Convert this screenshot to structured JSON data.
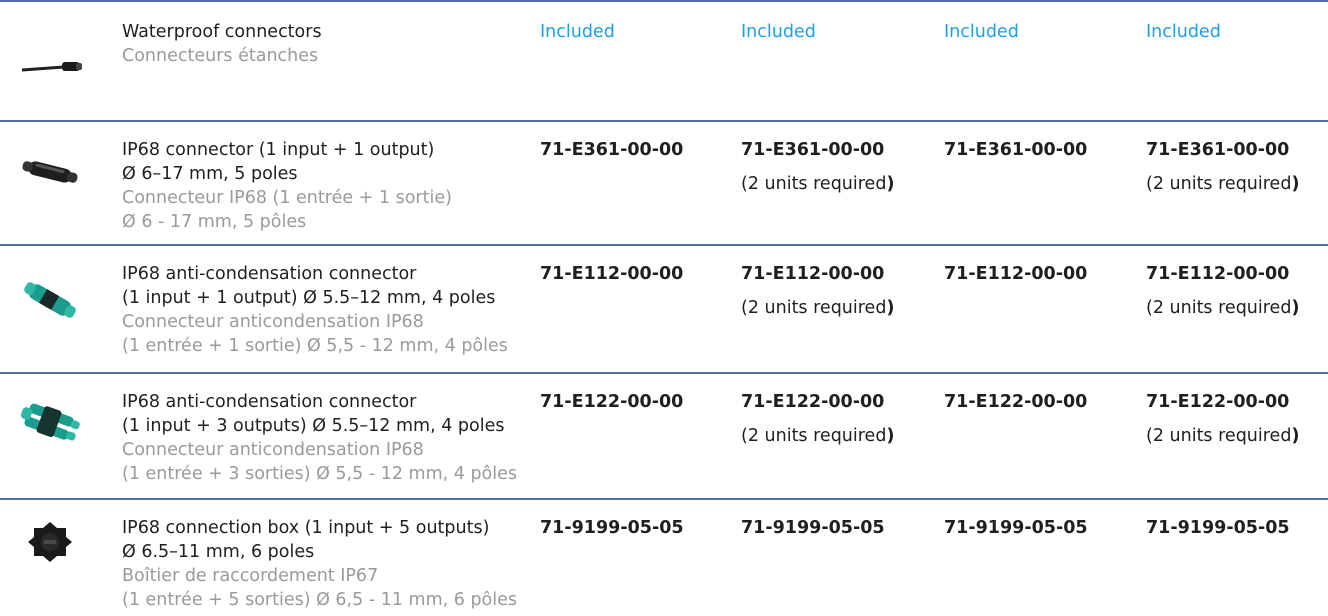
{
  "rows": [
    {
      "icon": "waterproof-connector-cable",
      "en_lines": [
        "Waterproof connectors"
      ],
      "fr_lines": [
        "Connecteurs étanches"
      ],
      "cells": [
        {
          "type": "included",
          "text": "Included"
        },
        {
          "type": "included",
          "text": "Included"
        },
        {
          "type": "included",
          "text": "Included"
        },
        {
          "type": "included",
          "text": "Included"
        }
      ]
    },
    {
      "icon": "ip68-connector",
      "en_lines": [
        "IP68 connector (1 input + 1 output)",
        "Ø 6–17 mm, 5 poles"
      ],
      "fr_lines": [
        "Connecteur IP68 (1 entrée + 1 sortie)",
        "Ø 6 - 17 mm, 5 pôles"
      ],
      "cells": [
        {
          "type": "code",
          "text": "71-E361-00-00"
        },
        {
          "type": "code",
          "text": "71-E361-00-00",
          "note": "(2 units required",
          "note_end": ")"
        },
        {
          "type": "code",
          "text": "71-E361-00-00"
        },
        {
          "type": "code",
          "text": "71-E361-00-00",
          "note": "(2 units required",
          "note_end": ")"
        }
      ]
    },
    {
      "icon": "ip68-anti-condensation-connector",
      "en_lines": [
        "IP68 anti-condensation connector",
        "(1 input + 1 output) Ø 5.5–12 mm, 4 poles"
      ],
      "fr_lines": [
        "Connecteur anticondensation IP68",
        "(1 entrée + 1 sortie) Ø 5,5 - 12 mm, 4 pôles"
      ],
      "cells": [
        {
          "type": "code",
          "text": "71-E112-00-00"
        },
        {
          "type": "code",
          "text": "71-E112-00-00",
          "note": "(2 units required",
          "note_end": ")"
        },
        {
          "type": "code",
          "text": "71-E112-00-00"
        },
        {
          "type": "code",
          "text": "71-E112-00-00",
          "note": "(2 units required",
          "note_end": ")"
        }
      ]
    },
    {
      "icon": "ip68-anti-condensation-connector-3-outputs",
      "en_lines": [
        "IP68 anti-condensation connector",
        "(1 input + 3 outputs) Ø 5.5–12 mm, 4 poles"
      ],
      "fr_lines": [
        "Connecteur anticondensation IP68",
        "(1 entrée + 3 sorties) Ø 5,5 - 12 mm, 4 pôles"
      ],
      "cells": [
        {
          "type": "code",
          "text": "71-E122-00-00"
        },
        {
          "type": "code",
          "text": "71-E122-00-00",
          "note": "(2 units required",
          "note_end": ")"
        },
        {
          "type": "code",
          "text": "71-E122-00-00"
        },
        {
          "type": "code",
          "text": "71-E122-00-00",
          "note": "(2 units required",
          "note_end": ")"
        }
      ]
    },
    {
      "icon": "ip68-connection-box",
      "en_lines": [
        "IP68 connection box (1 input + 5 outputs)",
        "Ø 6.5–11 mm, 6 poles"
      ],
      "fr_lines": [
        "Boîtier de raccordement IP67",
        "(1 entrée + 5 sorties) Ø 6,5 - 11 mm, 6 pôles"
      ],
      "cells": [
        {
          "type": "code",
          "text": "71-9199-05-05"
        },
        {
          "type": "code",
          "text": "71-9199-05-05"
        },
        {
          "type": "code",
          "text": "71-9199-05-05"
        },
        {
          "type": "code",
          "text": "71-9199-05-05"
        }
      ]
    }
  ]
}
